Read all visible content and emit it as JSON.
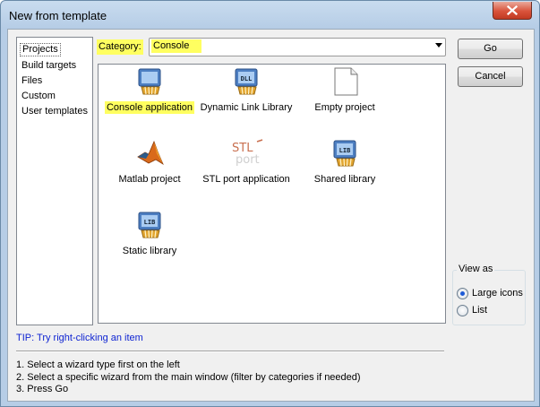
{
  "window": {
    "title": "New from template"
  },
  "sidebar": {
    "items": [
      {
        "label": "Projects",
        "selected": true
      },
      {
        "label": "Build targets"
      },
      {
        "label": "Files"
      },
      {
        "label": "Custom"
      },
      {
        "label": "User templates"
      }
    ]
  },
  "category": {
    "label": "Category:",
    "value": "Console"
  },
  "templates": [
    {
      "label": "Console application",
      "icon": "console-app-icon",
      "highlighted": true
    },
    {
      "label": "Dynamic Link Library",
      "icon": "dll-icon",
      "badge": "DLL"
    },
    {
      "label": "Empty project",
      "icon": "empty-project-icon"
    },
    {
      "label": "Matlab project",
      "icon": "matlab-icon"
    },
    {
      "label": "STL port application",
      "icon": "stlport-icon",
      "logo_top": "STL",
      "logo_bottom": "port"
    },
    {
      "label": "Shared library",
      "icon": "shared-library-icon",
      "badge": "LIB"
    },
    {
      "label": "Static library",
      "icon": "static-library-icon",
      "badge": "LIB"
    }
  ],
  "buttons": {
    "go": "Go",
    "cancel": "Cancel"
  },
  "view_as": {
    "title": "View as",
    "options": [
      {
        "label": "Large icons",
        "checked": true
      },
      {
        "label": "List",
        "checked": false
      }
    ]
  },
  "tip": "TIP: Try right-clicking an item",
  "instructions": [
    "1. Select a wizard type first on the left",
    "2. Select a specific wizard from the main window (filter by categories if needed)",
    "3. Press Go"
  ],
  "colors": {
    "highlight": "#ffff60",
    "tip": "#0f24d2",
    "title_bar": "#b6cde6"
  }
}
